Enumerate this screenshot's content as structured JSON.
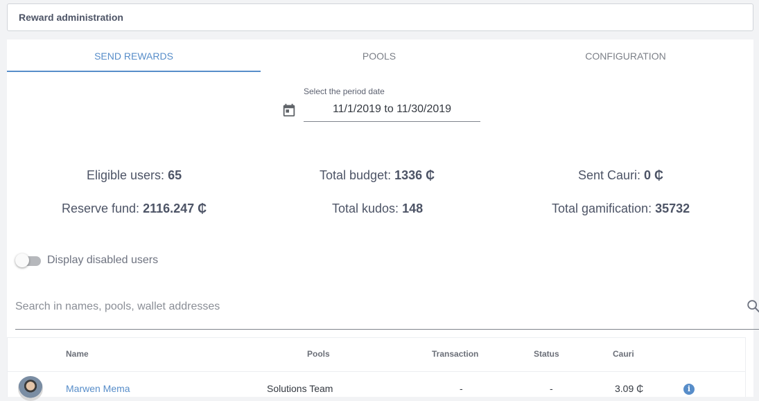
{
  "header": {
    "title": "Reward administration"
  },
  "tabs": [
    {
      "label": "SEND REWARDS",
      "active": true
    },
    {
      "label": "POOLS",
      "active": false
    },
    {
      "label": "CONFIGURATION",
      "active": false
    }
  ],
  "period": {
    "label": "Select the period date",
    "value": "11/1/2019 to 11/30/2019",
    "icon": "calendar-icon"
  },
  "stats": {
    "eligible_users": {
      "label": "Eligible users: ",
      "value": "65"
    },
    "total_budget": {
      "label": "Total budget: ",
      "value": "1336 ₵"
    },
    "sent_cauri": {
      "label": "Sent Cauri: ",
      "value": "0 ₵"
    },
    "reserve_fund": {
      "label": "Reserve fund: ",
      "value": "2116.247 ₵"
    },
    "total_kudos": {
      "label": "Total kudos: ",
      "value": "148"
    },
    "total_gamification": {
      "label": "Total gamification: ",
      "value": "35732"
    }
  },
  "toggle": {
    "label": "Display disabled users",
    "checked": false
  },
  "search": {
    "placeholder": "Search in names, pools, wallet addresses",
    "icon": "search-icon"
  },
  "table": {
    "headers": {
      "name": "Name",
      "pools": "Pools",
      "transaction": "Transaction",
      "status": "Status",
      "cauri": "Cauri"
    },
    "rows": [
      {
        "name": "Marwen Mema",
        "pool": "Solutions Team",
        "transaction": "-",
        "status": "-",
        "cauri": "3.09 ₵",
        "icon": "info-icon"
      }
    ]
  },
  "colors": {
    "accent": "#578dc9",
    "text": "#4d5466",
    "background": "#f2f3f5"
  }
}
